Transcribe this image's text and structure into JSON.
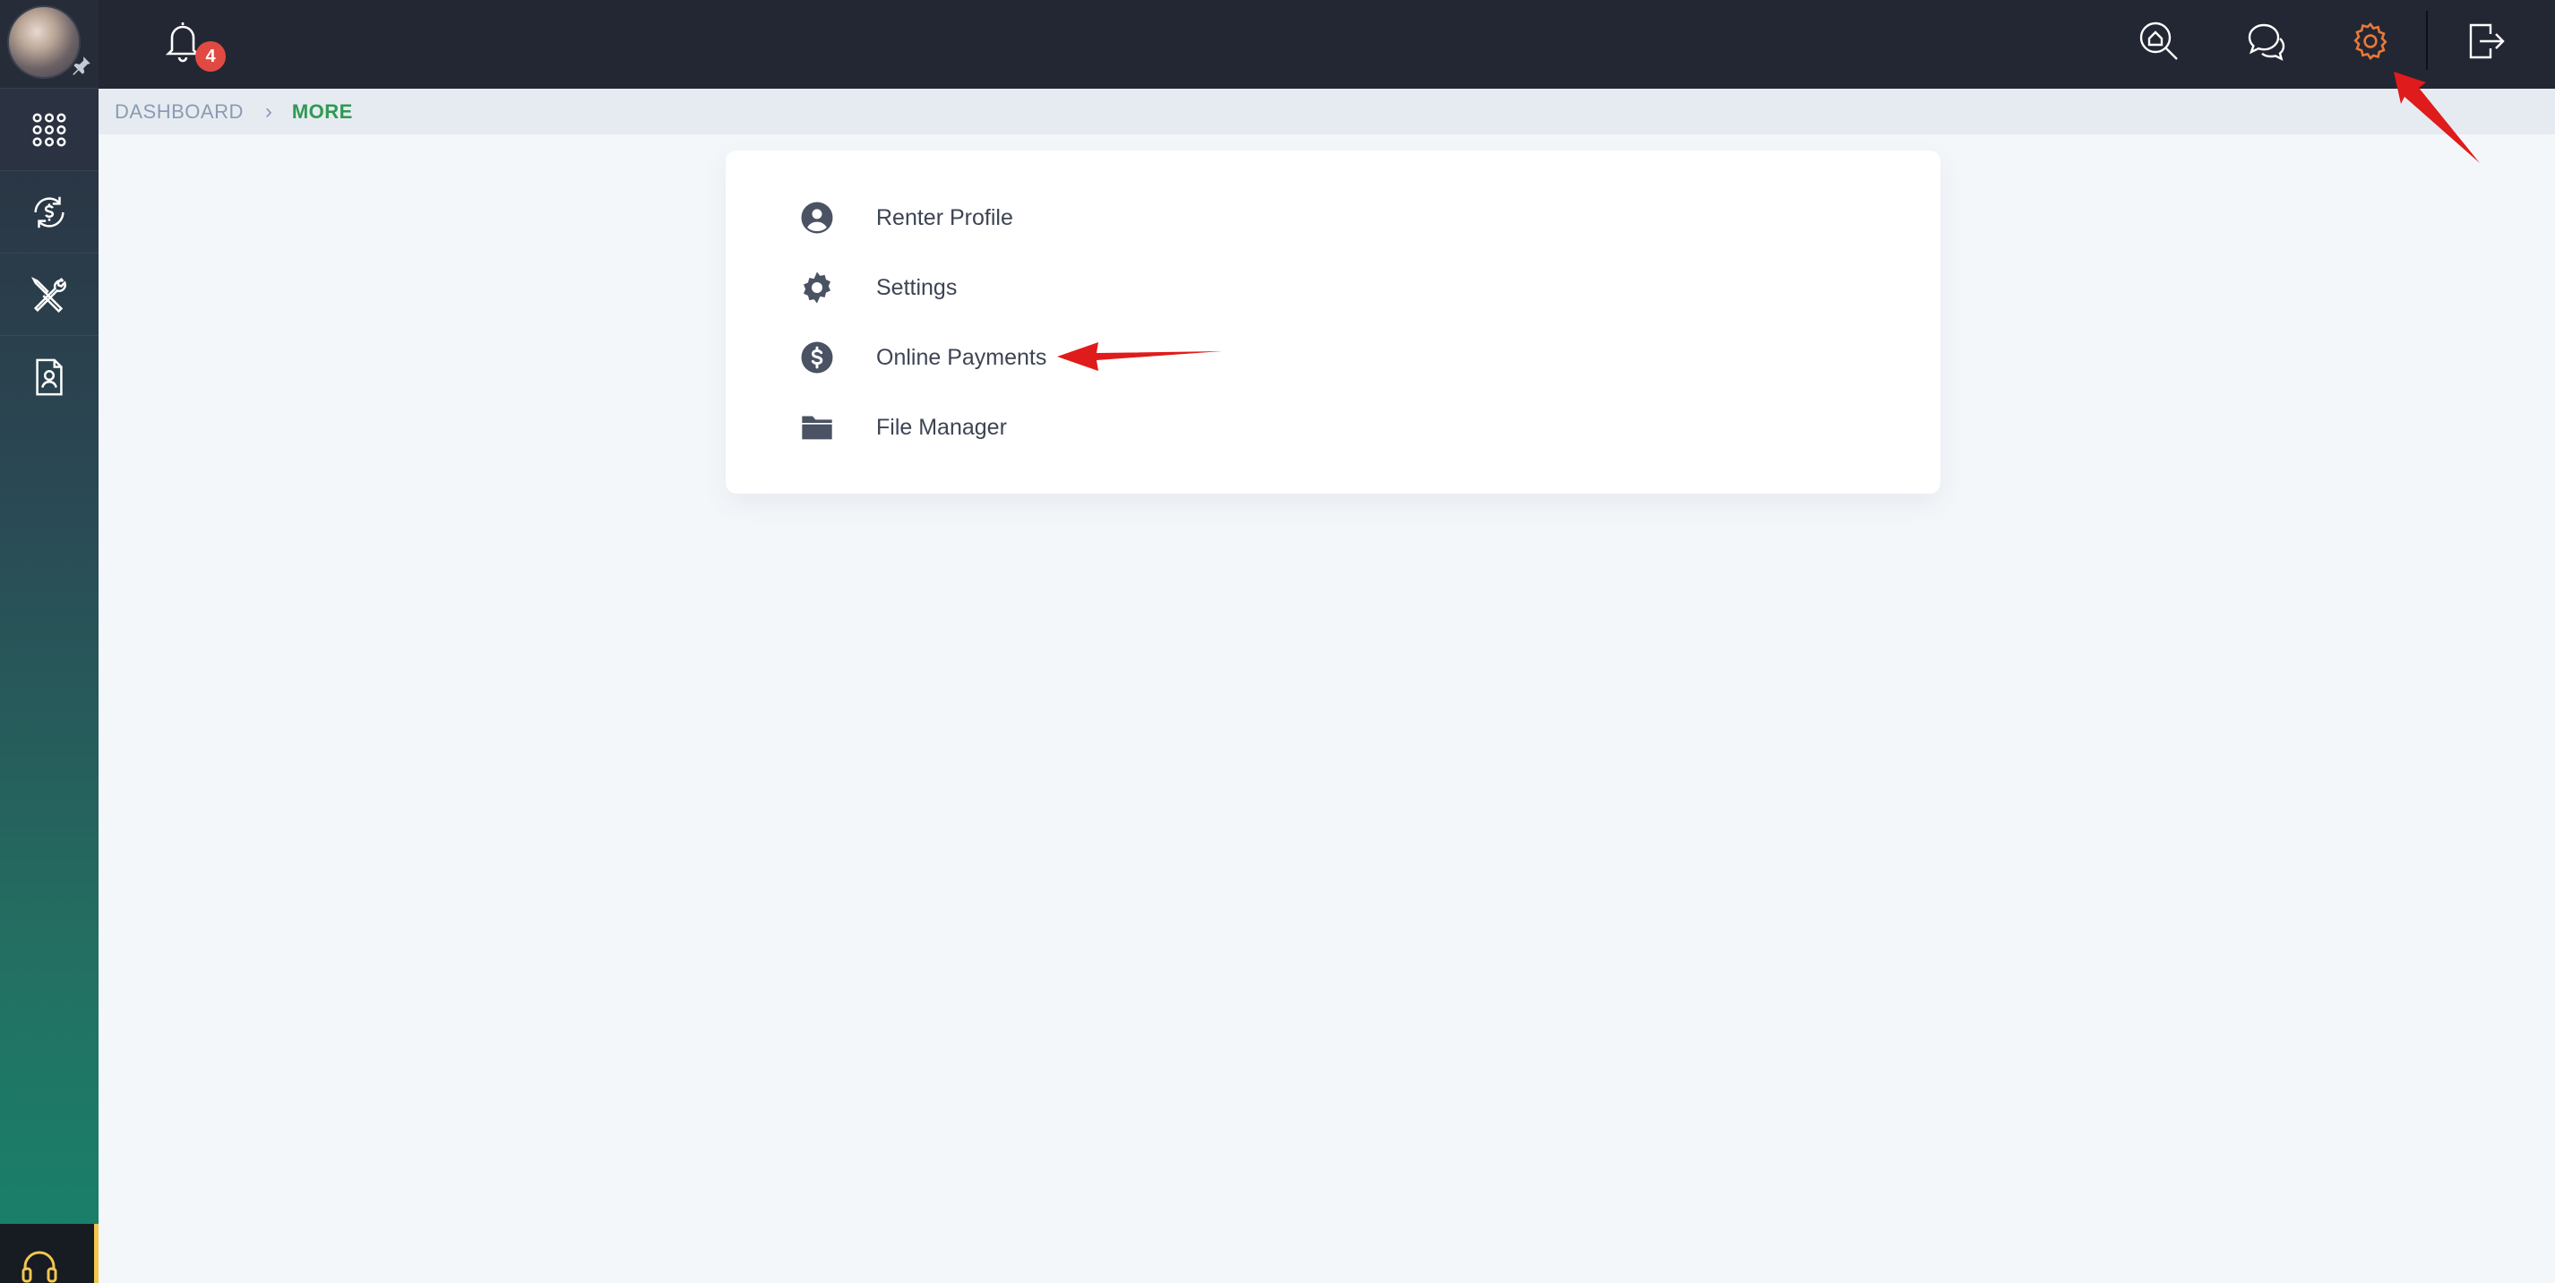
{
  "topbar": {
    "notifications_count": "4",
    "icons": [
      "bell-icon",
      "home-search-icon",
      "chat-icon",
      "gear-icon",
      "logout-icon"
    ],
    "active_color": "#e8793a"
  },
  "sidebar": {
    "items": [
      {
        "name": "apps-grid-icon"
      },
      {
        "name": "payments-cycle-icon"
      },
      {
        "name": "tools-icon"
      },
      {
        "name": "contact-document-icon"
      }
    ],
    "support_icon": "headset-icon"
  },
  "breadcrumb": {
    "parent": "DASHBOARD",
    "current": "MORE"
  },
  "menu": {
    "items": [
      {
        "label": "Renter Profile",
        "icon": "user-circle-icon"
      },
      {
        "label": "Settings",
        "icon": "gear-icon"
      },
      {
        "label": "Online Payments",
        "icon": "dollar-circle-icon"
      },
      {
        "label": "File Manager",
        "icon": "folder-icon"
      }
    ]
  },
  "colors": {
    "topbar_bg": "#232733",
    "breadcrumb_current": "#2f9a52",
    "annotation_red": "#e01b1b"
  }
}
